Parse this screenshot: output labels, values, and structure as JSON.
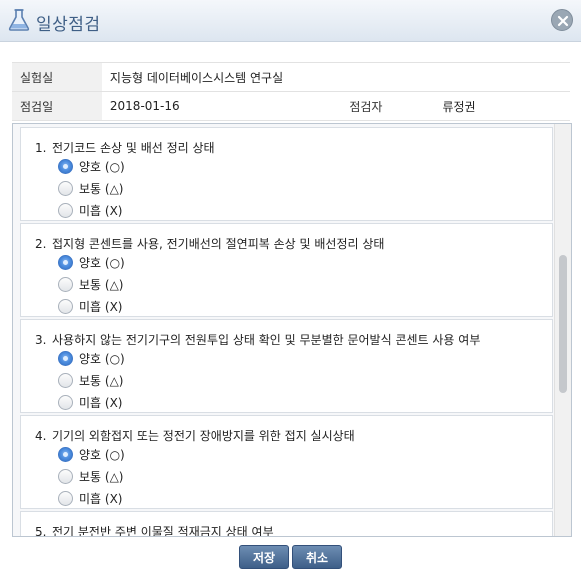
{
  "dialog": {
    "title": "일상점검",
    "title_icon": "flask-icon",
    "close_icon": "close-icon"
  },
  "info": {
    "lab_label": "실험실",
    "lab_value": "지능형 데이터베이스시스템 연구실",
    "date_label": "점검일",
    "date_value": "2018-01-16",
    "inspector_label": "점검자",
    "inspector_value": "류정권"
  },
  "options": [
    "양호 (○)",
    "보통 (△)",
    "미흡 (X)"
  ],
  "questions": [
    {
      "num": "1.",
      "text": "전기코드 손상 및 배선 정리 상태",
      "selected": 0
    },
    {
      "num": "2.",
      "text": "접지형 콘센트를 사용, 전기배선의 절연피복 손상 및 배선정리 상태",
      "selected": 0
    },
    {
      "num": "3.",
      "text": "사용하지 않는 전기기구의 전원투입 상태 확인 및 무분별한 문어발식 콘센트 사용 여부",
      "selected": 0
    },
    {
      "num": "4.",
      "text": "기기의 외함접지 또는 정전기 장애방지를 위한 접지 실시상태",
      "selected": 0
    },
    {
      "num": "5.",
      "text": "전기 분전반 주변 이물질 적재금지 상태 여부",
      "selected": 0
    }
  ],
  "buttons": {
    "save": "저장",
    "cancel": "취소"
  },
  "colors": {
    "title": "#3f5f86",
    "button": "#4a6a92",
    "radio_selected": "#4f8fe0"
  }
}
